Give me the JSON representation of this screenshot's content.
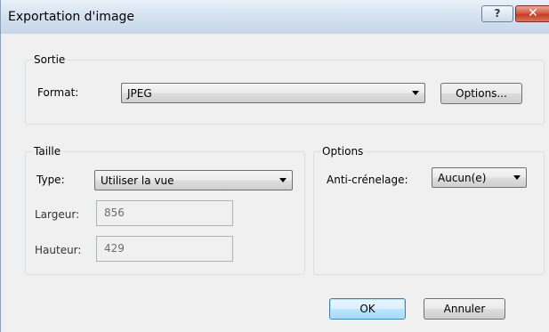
{
  "window": {
    "title": "Exportation d'image",
    "help_label": "?",
    "close_label": "✕"
  },
  "output_group": {
    "legend": "Sortie",
    "format_label": "Format:",
    "format_value": "JPEG",
    "options_button": "Options..."
  },
  "size_group": {
    "legend": "Taille",
    "type_label": "Type:",
    "type_value": "Utiliser la vue",
    "width_label": "Largeur:",
    "width_value": "856",
    "height_label": "Hauteur:",
    "height_value": "429"
  },
  "options_group": {
    "legend": "Options",
    "antialias_label": "Anti-crénelage:",
    "antialias_value": "Aucun(e)"
  },
  "footer": {
    "ok_label": "OK",
    "cancel_label": "Annuler"
  }
}
